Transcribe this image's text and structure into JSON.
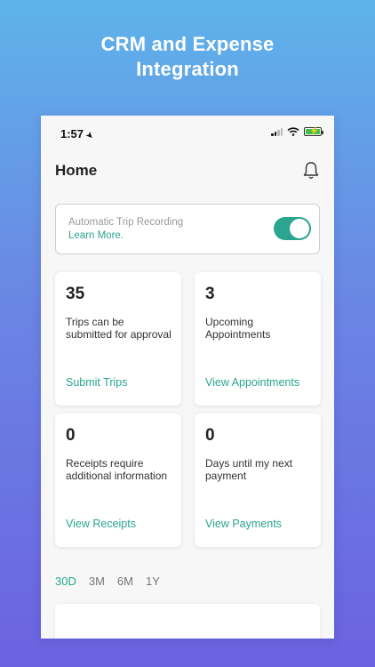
{
  "headline": {
    "line1": "CRM and Expense",
    "line2": "Integration"
  },
  "status_bar": {
    "time": "1:57",
    "location_icon": "location-arrow-icon"
  },
  "header": {
    "title": "Home",
    "bell_icon": "bell-icon"
  },
  "trip_recording": {
    "label": "Automatic Trip Recording",
    "link": "Learn More.",
    "enabled": true,
    "accent": "#2aa58f"
  },
  "cards": [
    {
      "value": "35",
      "description": "Trips can be submitted for approval",
      "link": "Submit Trips"
    },
    {
      "value": "3",
      "description": "Upcoming Appointments",
      "link": "View Appointments"
    },
    {
      "value": "0",
      "description": "Receipts require additional information",
      "link": "View Receipts"
    },
    {
      "value": "0",
      "description": "Days until my next payment",
      "link": "View Payments"
    }
  ],
  "time_ranges": [
    "30D",
    "3M",
    "6M",
    "1Y"
  ],
  "selected_range": "30D",
  "colors": {
    "accent": "#2aa58f",
    "background_top": "#5eb3ea",
    "background_bottom": "#6b62e0"
  }
}
